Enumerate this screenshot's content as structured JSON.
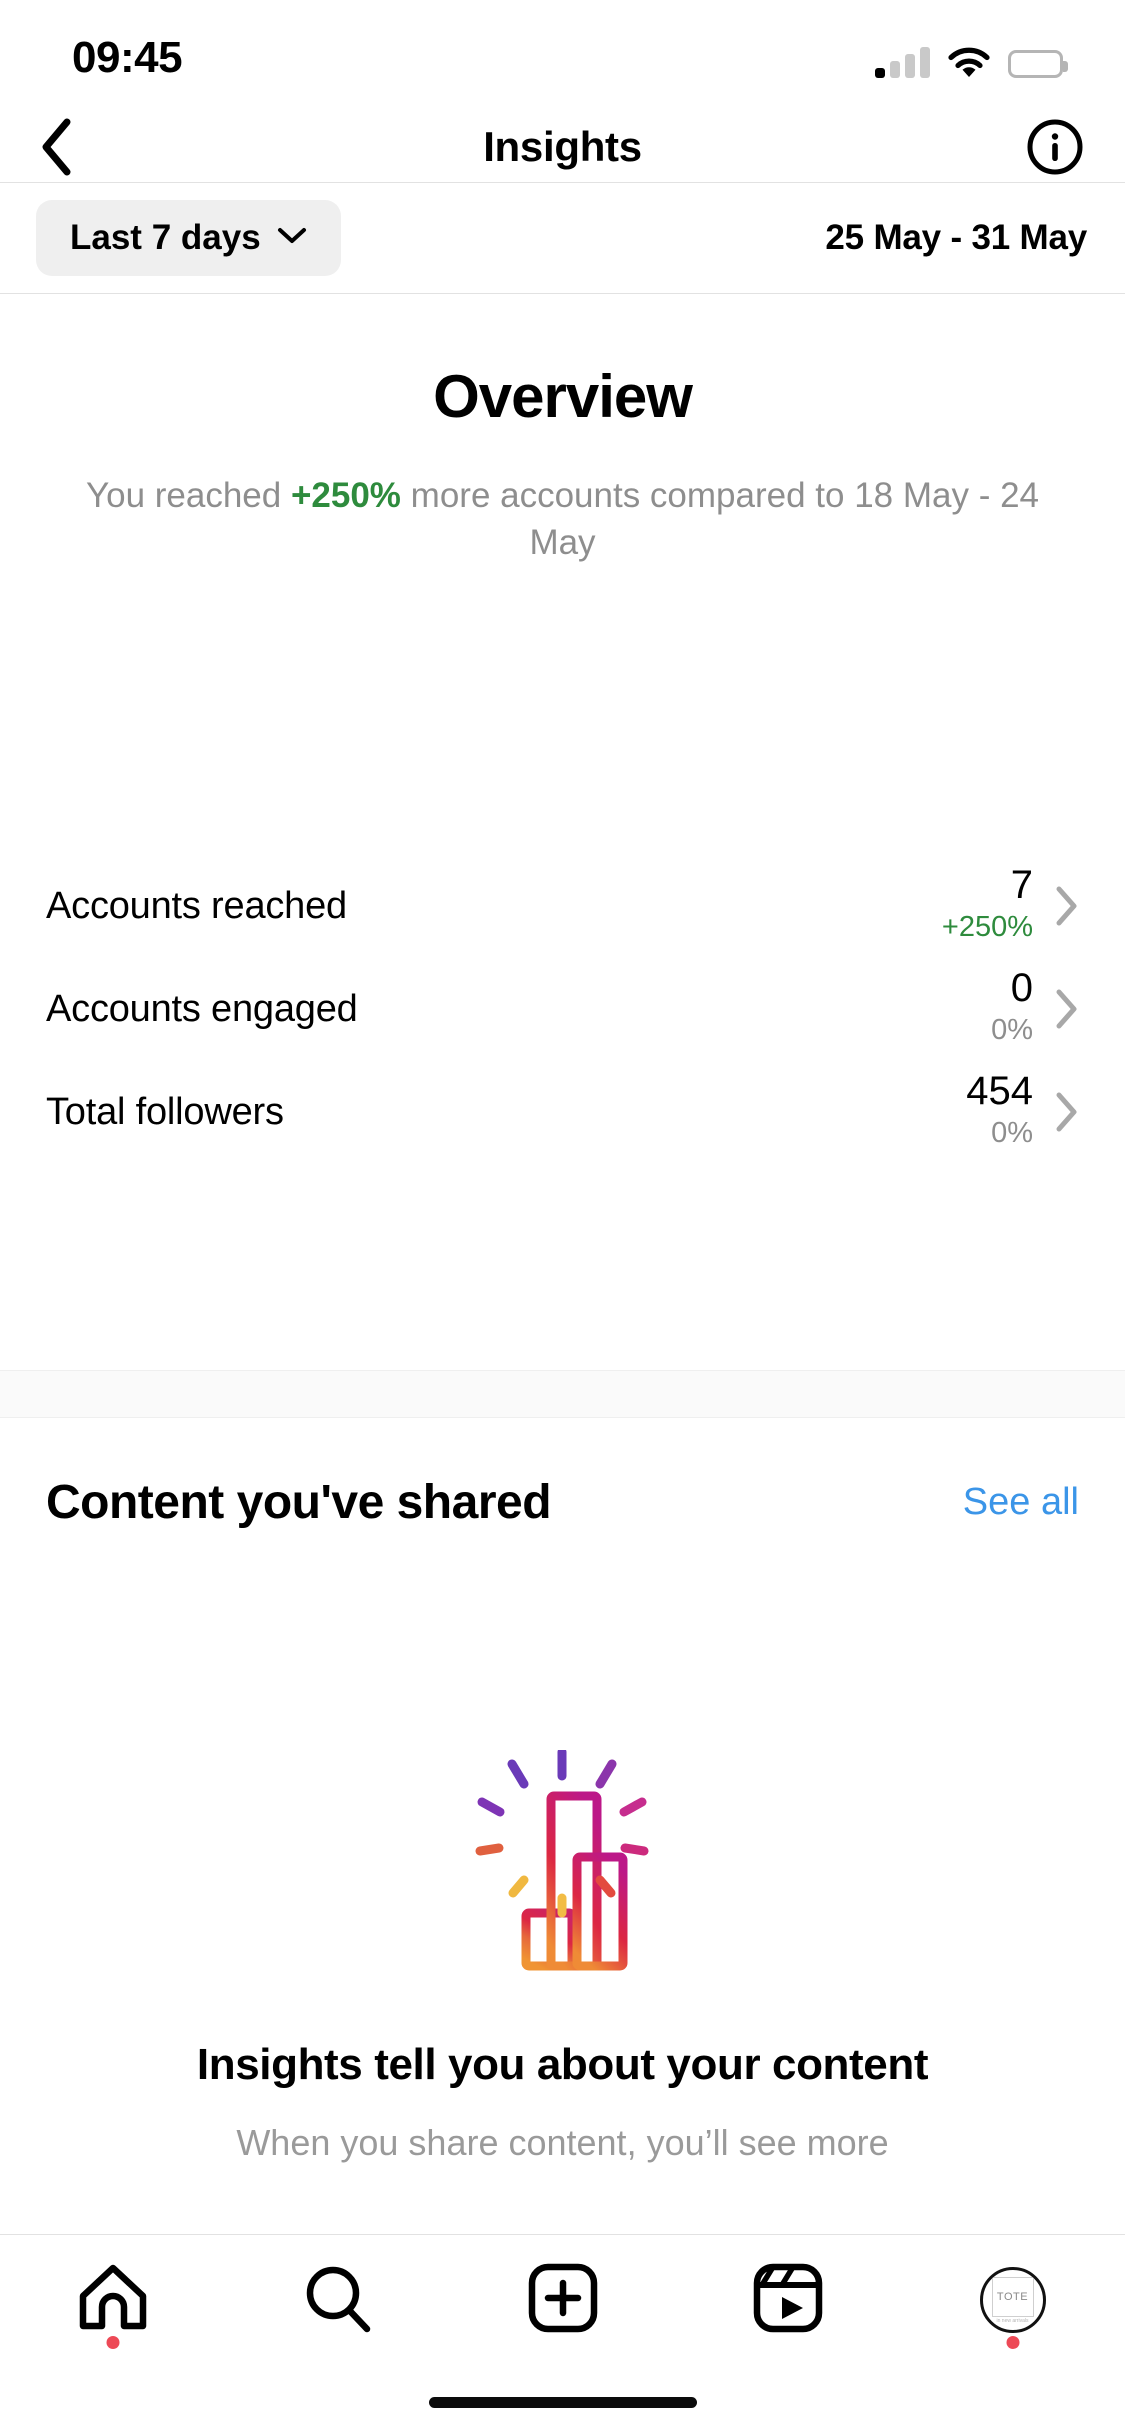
{
  "status_bar": {
    "time": "09:45",
    "signal_icon": "cellular-signal-icon",
    "wifi_icon": "wifi-icon",
    "battery_icon": "battery-full-icon"
  },
  "header": {
    "back_icon": "chevron-left-icon",
    "title": "Insights",
    "info_icon": "info-circle-icon"
  },
  "filter": {
    "chip_label": "Last 7 days",
    "chip_chevron_icon": "chevron-down-icon",
    "date_range": "25 May - 31 May"
  },
  "overview": {
    "title": "Overview",
    "summary_prefix": "You reached ",
    "summary_highlight": "+250%",
    "summary_suffix": " more accounts compared to 18 May - 24 May",
    "highlight_color": "#2e8b3d",
    "metrics": [
      {
        "label": "Accounts reached",
        "value": "7",
        "delta": "+250%",
        "delta_positive": true,
        "chevron_icon": "chevron-right-icon"
      },
      {
        "label": "Accounts engaged",
        "value": "0",
        "delta": "0%",
        "delta_positive": false,
        "chevron_icon": "chevron-right-icon"
      },
      {
        "label": "Total followers",
        "value": "454",
        "delta": "0%",
        "delta_positive": false,
        "chevron_icon": "chevron-right-icon"
      }
    ]
  },
  "content_shared": {
    "title": "Content you've shared",
    "see_all_label": "See all",
    "see_all_color": "#3b95e8"
  },
  "empty_state": {
    "illustration_icon": "bar-chart-sparkle-icon",
    "title": "Insights tell you about your content",
    "subtitle": "When you share content, you’ll see more"
  },
  "tabbar": {
    "items": [
      {
        "icon": "home-icon",
        "badge": true
      },
      {
        "icon": "search-icon",
        "badge": false
      },
      {
        "icon": "create-plus-icon",
        "badge": false
      },
      {
        "icon": "reels-icon",
        "badge": false
      },
      {
        "icon": "profile-avatar-icon",
        "badge": true,
        "avatar_text": "TOTE",
        "avatar_subtext": "in new arrivals"
      }
    ]
  }
}
